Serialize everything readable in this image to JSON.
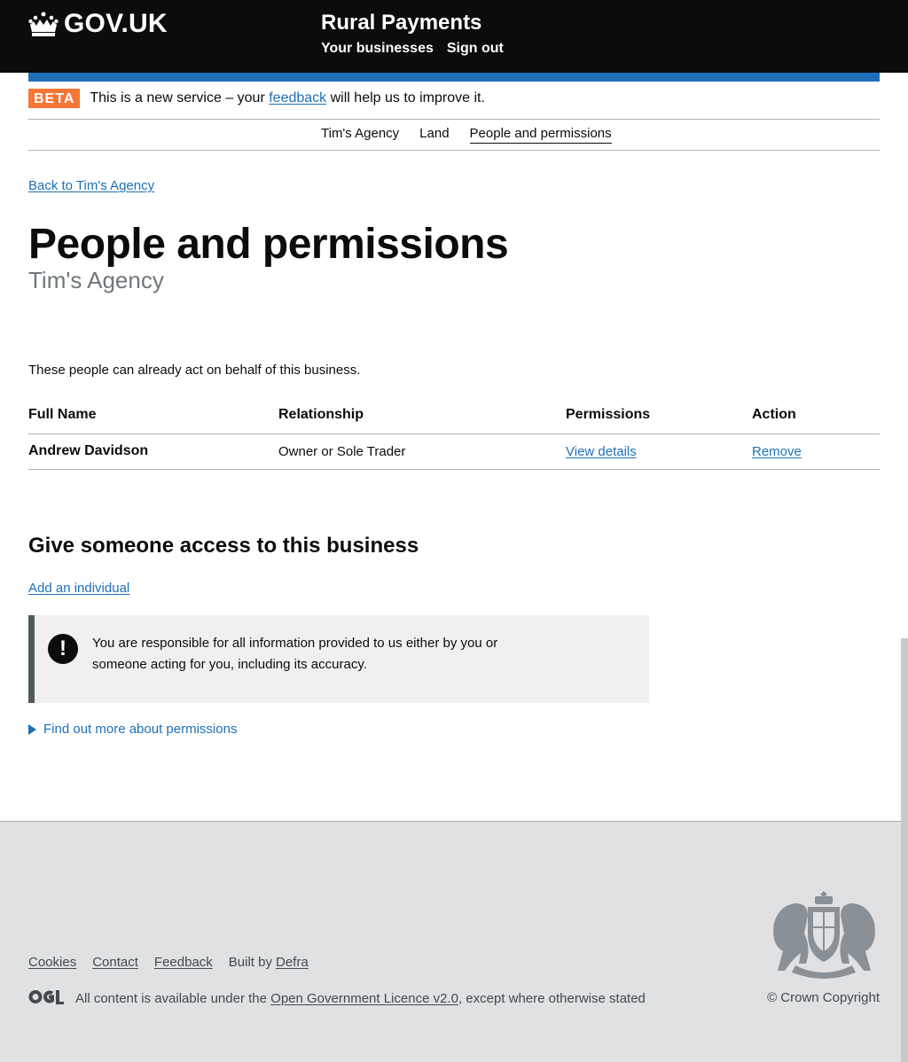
{
  "header": {
    "logo_text": "GOV.UK",
    "service_name": "Rural Payments",
    "nav": [
      "Your businesses",
      "Sign out"
    ]
  },
  "phase_banner": {
    "tag": "BETA",
    "text_before": "This is a new service – your",
    "link": "feedback",
    "text_after": "will help us to improve it."
  },
  "sub_nav": {
    "items": [
      "Tim's Agency",
      "Land",
      "People and permissions"
    ],
    "current": "People and permissions"
  },
  "back_link": "Back to Tim's Agency",
  "page": {
    "title": "People and permissions",
    "caption": "Tim's Agency",
    "intro": "These people can already act on behalf of this business."
  },
  "table": {
    "headers": [
      "Full Name",
      "Relationship",
      "Permissions",
      "Action"
    ],
    "rows": [
      {
        "name": "Andrew Davidson",
        "relationship": "Owner or Sole Trader",
        "permissions": "View details",
        "action": "Remove"
      }
    ]
  },
  "access": {
    "heading": "Give someone access to this business",
    "add_link": "Add an individual"
  },
  "warning": {
    "icon": "!",
    "text": "You are responsible for all information provided to us either by you or someone acting for you, including its accuracy."
  },
  "details": {
    "summary": "Find out more about permissions"
  },
  "footer": {
    "links": [
      "Cookies",
      "Contact",
      "Feedback"
    ],
    "built_by_text": "Built by",
    "built_by_link": "Defra",
    "licence_before": "All content is available under the",
    "licence_link": "Open Government Licence v2.0",
    "licence_after": ", except where otherwise stated",
    "copyright": "© Crown Copyright"
  },
  "colors": {
    "header_bg": "#0b0c0c",
    "link": "#1d70b8",
    "beta_tag": "#f47738",
    "footer_bg": "#dfe1e2"
  }
}
